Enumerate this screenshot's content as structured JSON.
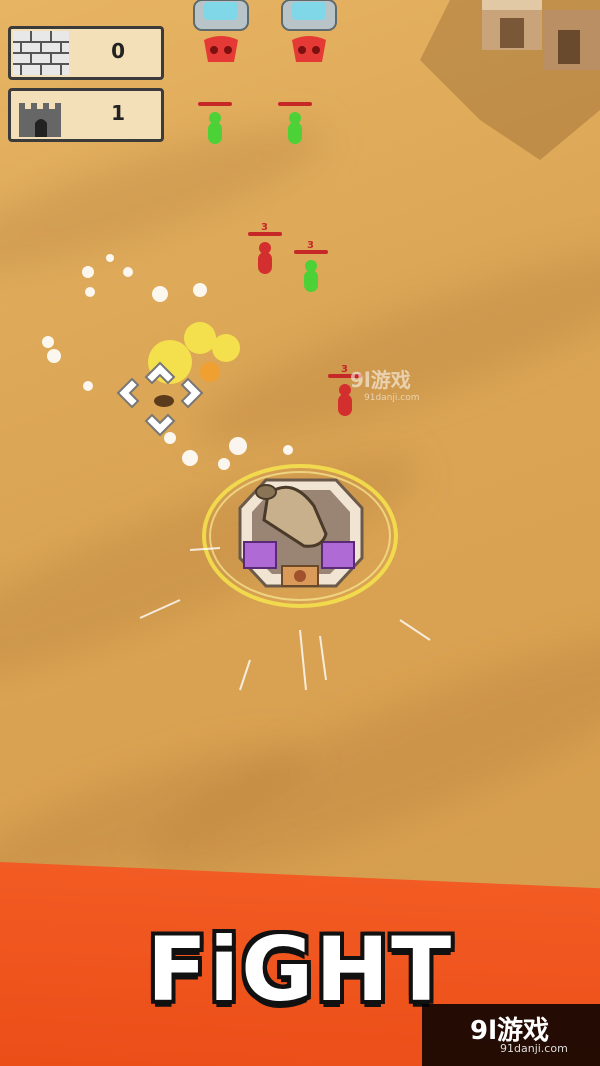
{
  "hud": {
    "walls_count": "0",
    "towers_count": "1",
    "walls_icon": "brick-wall-icon",
    "towers_icon": "castle-tower-icon"
  },
  "enemies": [
    {
      "team": "green",
      "hp_label": ""
    },
    {
      "team": "green",
      "hp_label": ""
    },
    {
      "team": "red",
      "hp_label": "3"
    },
    {
      "team": "green",
      "hp_label": "3"
    },
    {
      "team": "red",
      "hp_label": "3"
    }
  ],
  "banner": {
    "title": "FiGHT"
  },
  "watermark": {
    "brand": "9l游戏",
    "domain": "91danji.com"
  },
  "colors": {
    "sand": "#dba656",
    "banner": "#ef5320",
    "enemy_green": "#4cd137",
    "enemy_red": "#d32f2f",
    "spawn_red": "#e53935",
    "glow_yellow": "#f4e04d"
  }
}
